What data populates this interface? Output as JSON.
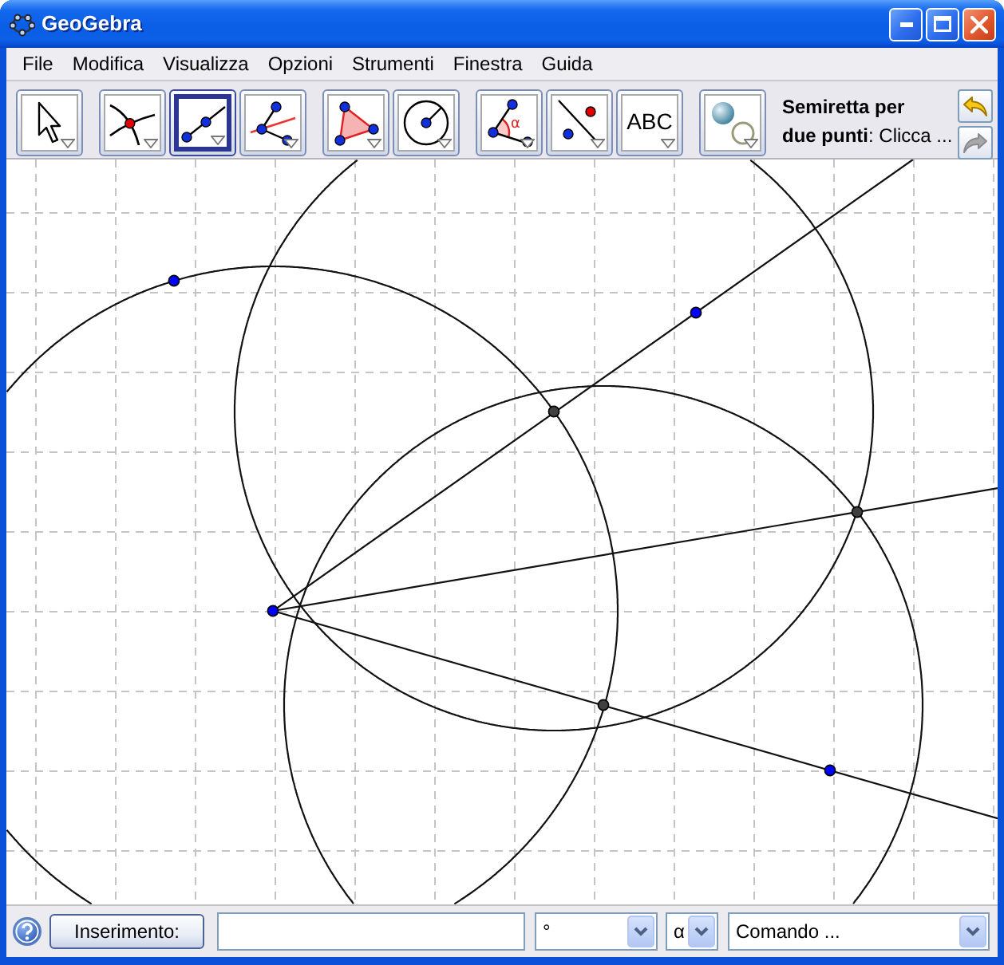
{
  "window": {
    "title": "GeoGebra"
  },
  "menu": [
    "File",
    "Modifica",
    "Visualizza",
    "Opzioni",
    "Strumenti",
    "Finestra",
    "Guida"
  ],
  "toolbar": {
    "groups": [
      {
        "tools": [
          {
            "selected": false
          }
        ]
      },
      {
        "tools": [
          {
            "selected": false
          },
          {
            "selected": true
          },
          {
            "selected": false
          }
        ]
      },
      {
        "tools": [
          {
            "selected": false
          },
          {
            "selected": false
          }
        ]
      },
      {
        "tools": [
          {
            "selected": false,
            "glyph": "α"
          },
          {
            "selected": false
          },
          {
            "selected": false,
            "label": "ABC"
          }
        ]
      },
      {
        "tools": [
          {
            "selected": false
          }
        ]
      }
    ],
    "tool_help": "**Semiretta per**\n**due punti**: Clicca ...",
    "undo": {
      "disabled": false
    },
    "redo": {
      "disabled": true
    }
  },
  "canvas": {
    "points": [
      {
        "color": "#0000ff"
      },
      {
        "color": "#0000ff"
      },
      {
        "color": "#0000ff"
      },
      {
        "color": "#0000ff"
      },
      {
        "color": "#404040"
      },
      {
        "color": "#404040"
      },
      {
        "color": "#404040"
      }
    ]
  },
  "input_bar": {
    "button": "Inserimento:",
    "symbols": "°",
    "greek": "α",
    "commands": "Comando ..."
  }
}
